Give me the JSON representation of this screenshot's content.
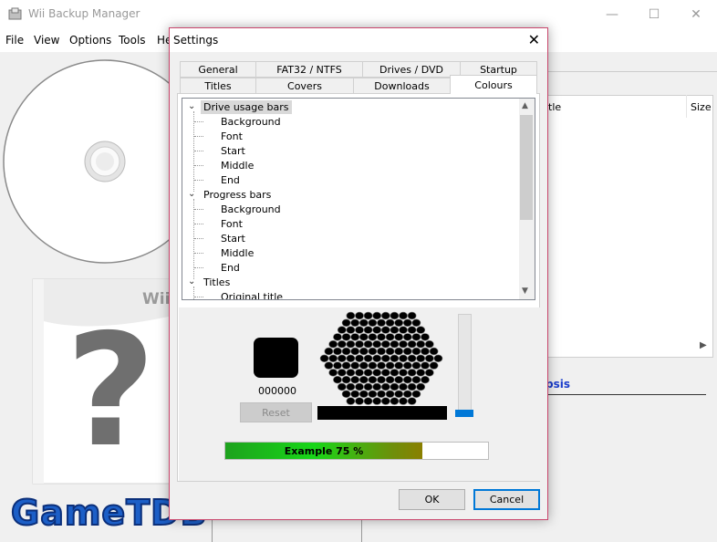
{
  "window": {
    "title": "Wii Backup Manager",
    "min_glyph": "—",
    "max_glyph": "☐",
    "close_glyph": "✕"
  },
  "menu": {
    "items": [
      "File",
      "View",
      "Options",
      "Tools",
      "He"
    ]
  },
  "title_list": {
    "columns": [
      "itle",
      "Size"
    ],
    "synopsis_label": "psis"
  },
  "cover": {
    "box_brand": "Wii",
    "placeholder_glyph": "?",
    "gametdb_logo": "GameTDB"
  },
  "dialog": {
    "title": "Settings",
    "close_glyph": "✕",
    "tabs_row1": [
      "General",
      "FAT32 / NTFS",
      "Drives / DVD",
      "Startup"
    ],
    "tabs_row2": [
      "Titles",
      "Covers",
      "Downloads",
      "Colours"
    ],
    "active_tab": "Colours",
    "tree": [
      {
        "label": "Drive usage bars",
        "level": 0,
        "selected": true
      },
      {
        "label": "Background",
        "level": 1
      },
      {
        "label": "Font",
        "level": 1
      },
      {
        "label": "Start",
        "level": 1
      },
      {
        "label": "Middle",
        "level": 1
      },
      {
        "label": "End",
        "level": 1
      },
      {
        "label": "Progress bars",
        "level": 0
      },
      {
        "label": "Background",
        "level": 1
      },
      {
        "label": "Font",
        "level": 1
      },
      {
        "label": "Start",
        "level": 1
      },
      {
        "label": "Middle",
        "level": 1
      },
      {
        "label": "End",
        "level": 1
      },
      {
        "label": "Titles",
        "level": 0
      },
      {
        "label": "Original title",
        "level": 1
      }
    ],
    "color_code": "000000",
    "reset_label": "Reset",
    "example_label": "Example 75 %",
    "example_progress": 0.75,
    "slider_level": 0.05,
    "ok_label": "OK",
    "cancel_label": "Cancel",
    "colors": {
      "selected_color": "#000000",
      "accent": "#0078d7",
      "dialog_border": "#c9466c"
    }
  }
}
